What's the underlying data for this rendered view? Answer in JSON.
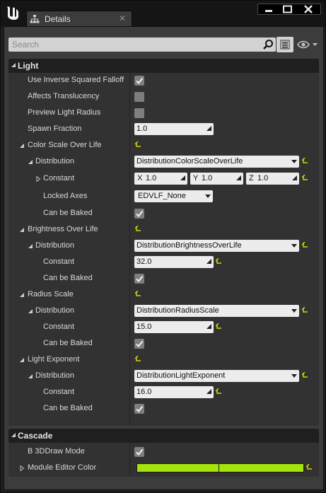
{
  "window": {
    "tab_title": "Details",
    "tab_close": "✕",
    "logo_icon": "unreal-engine-logo",
    "window_buttons": [
      "minimize",
      "maximize",
      "close"
    ]
  },
  "toolbar": {
    "search_placeholder": "Search",
    "search_icon": "magnifier",
    "list_view_icon": "property-matrix",
    "visibility_icon": "eye"
  },
  "colors": {
    "panel": "#3c3c3c",
    "header": "#1f1f1f",
    "field": "#ececec",
    "reset_arrow": "#d4d400",
    "module_color": "#a5e30b"
  },
  "sections": {
    "light": {
      "title": "Light",
      "use_inverse_squared_falloff": {
        "label": "Use Inverse Squared Falloff",
        "checked": true
      },
      "affects_translucency": {
        "label": "Affects Translucency",
        "checked": false
      },
      "preview_light_radius": {
        "label": "Preview Light Radius",
        "checked": false
      },
      "spawn_fraction": {
        "label": "Spawn Fraction",
        "value": "1.0"
      },
      "color_scale_over_life": {
        "label": "Color Scale Over Life",
        "distribution": {
          "label": "Distribution",
          "value": "DistributionColorScaleOverLife"
        },
        "constant": {
          "label": "Constant",
          "x_label": "X",
          "x": "1.0",
          "y_label": "Y",
          "y": "1.0",
          "z_label": "Z",
          "z": "1.0"
        },
        "locked_axes": {
          "label": "Locked Axes",
          "value": "EDVLF_None"
        },
        "can_be_baked": {
          "label": "Can be Baked",
          "checked": true
        }
      },
      "brightness_over_life": {
        "label": "Brightness Over Life",
        "distribution": {
          "label": "Distribution",
          "value": "DistributionBrightnessOverLife"
        },
        "constant": {
          "label": "Constant",
          "value": "32.0"
        },
        "can_be_baked": {
          "label": "Can be Baked",
          "checked": true
        }
      },
      "radius_scale": {
        "label": "Radius Scale",
        "distribution": {
          "label": "Distribution",
          "value": "DistributionRadiusScale"
        },
        "constant": {
          "label": "Constant",
          "value": "15.0"
        },
        "can_be_baked": {
          "label": "Can be Baked",
          "checked": true
        }
      },
      "light_exponent": {
        "label": "Light Exponent",
        "distribution": {
          "label": "Distribution",
          "value": "DistributionLightExponent"
        },
        "constant": {
          "label": "Constant",
          "value": "16.0"
        },
        "can_be_baked": {
          "label": "Can be Baked",
          "checked": true
        }
      }
    },
    "cascade": {
      "title": "Cascade",
      "b_3d_draw_mode": {
        "label": "B 3DDraw Mode",
        "checked": true
      },
      "module_editor_color": {
        "label": "Module Editor Color"
      }
    }
  }
}
